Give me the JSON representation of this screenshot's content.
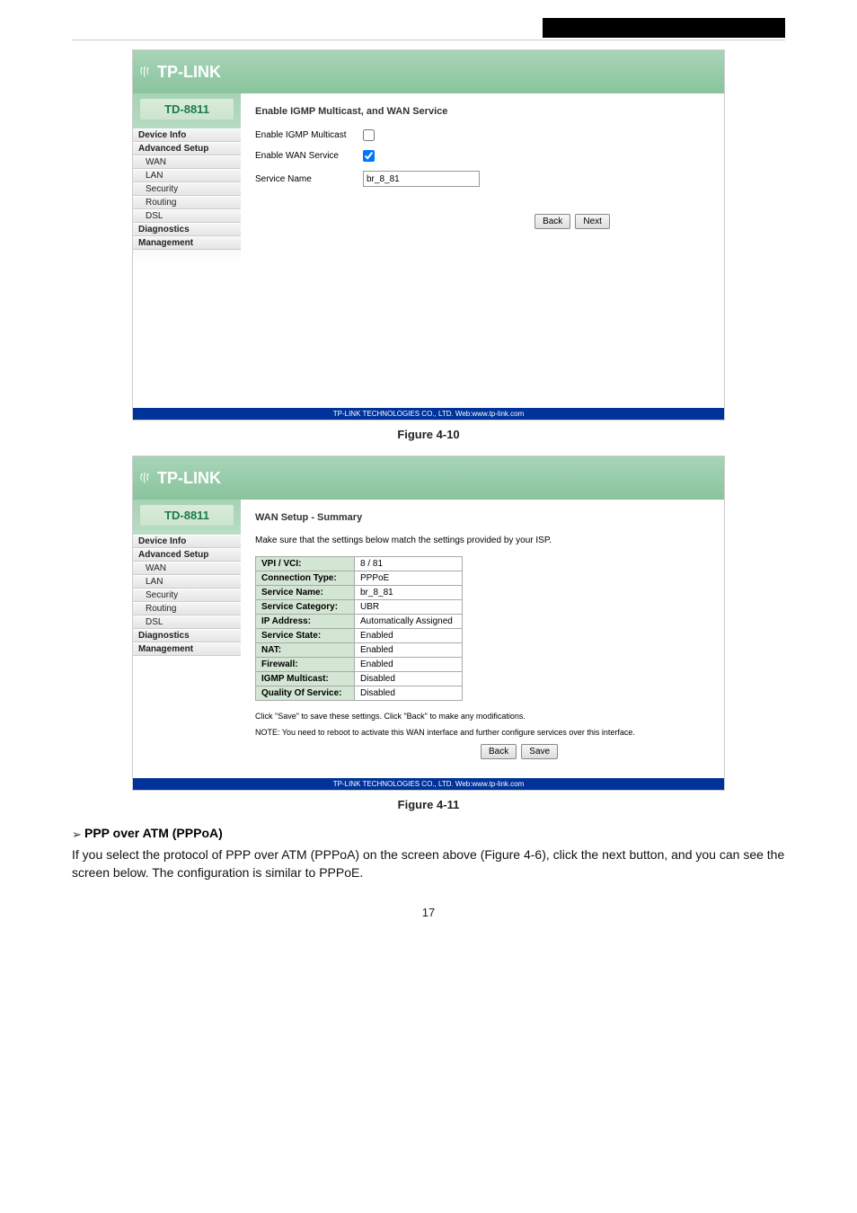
{
  "header": {
    "black_bar": ""
  },
  "brand": "TP-LINK",
  "model": "TD-8811",
  "nav": {
    "device_info": "Device Info",
    "advanced_setup": "Advanced Setup",
    "wan": "WAN",
    "lan": "LAN",
    "security": "Security",
    "routing": "Routing",
    "dsl": "DSL",
    "diagnostics": "Diagnostics",
    "management": "Management"
  },
  "screen1": {
    "title": "Enable IGMP Multicast, and WAN Service",
    "igmp_label": "Enable IGMP Multicast",
    "wan_label": "Enable WAN Service",
    "service_name_label": "Service Name",
    "service_name_value": "br_8_81",
    "back": "Back",
    "next": "Next"
  },
  "footer_text": "TP-LINK TECHNOLOGIES CO., LTD. Web:www.tp-link.com",
  "figure1": "Figure 4-10",
  "screen2": {
    "title": "WAN Setup - Summary",
    "subtitle": "Make sure that the settings below match the settings provided by your ISP.",
    "rows": {
      "vpi": {
        "k": "VPI / VCI:",
        "v": "8 / 81"
      },
      "conn": {
        "k": "Connection Type:",
        "v": "PPPoE"
      },
      "svc": {
        "k": "Service Name:",
        "v": "br_8_81"
      },
      "cat": {
        "k": "Service Category:",
        "v": "UBR"
      },
      "ip": {
        "k": "IP Address:",
        "v": "Automatically Assigned"
      },
      "state": {
        "k": "Service State:",
        "v": "Enabled"
      },
      "nat": {
        "k": "NAT:",
        "v": "Enabled"
      },
      "fw": {
        "k": "Firewall:",
        "v": "Enabled"
      },
      "igmp": {
        "k": "IGMP Multicast:",
        "v": "Disabled"
      },
      "qos": {
        "k": "Quality Of Service:",
        "v": "Disabled"
      }
    },
    "note1": "Click \"Save\" to save these settings. Click \"Back\" to make any modifications.",
    "note2": "NOTE: You need to reboot to activate this WAN interface and further configure services over this interface.",
    "back": "Back",
    "save": "Save"
  },
  "figure2": "Figure 4-11",
  "bullet1": "PPP over ATM (PPPoA)",
  "para1": "If you select the protocol of PPP over ATM (PPPoA) on the screen above (Figure 4-6), click the next button, and you can see the screen below. The configuration is similar to PPPoE.",
  "page_num": "17"
}
